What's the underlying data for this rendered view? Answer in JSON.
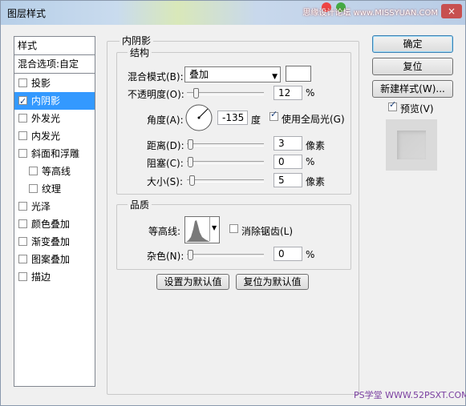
{
  "window": {
    "title": "图层样式",
    "watermark": "思缘设计论坛 www.MISSYUAN.COM",
    "close": "×"
  },
  "styles": {
    "header": "样式",
    "blend_options": "混合选项:自定",
    "items": [
      {
        "label": "投影",
        "checked": false
      },
      {
        "label": "内阴影",
        "checked": true
      },
      {
        "label": "外发光",
        "checked": false
      },
      {
        "label": "内发光",
        "checked": false
      },
      {
        "label": "斜面和浮雕",
        "checked": false
      },
      {
        "label": "等高线",
        "checked": false
      },
      {
        "label": "纹理",
        "checked": false
      },
      {
        "label": "光泽",
        "checked": false
      },
      {
        "label": "颜色叠加",
        "checked": false
      },
      {
        "label": "渐变叠加",
        "checked": false
      },
      {
        "label": "图案叠加",
        "checked": false
      },
      {
        "label": "描边",
        "checked": false
      }
    ]
  },
  "inner_shadow": {
    "title": "内阴影",
    "structure": {
      "title": "结构",
      "blend_mode_label": "混合模式(B):",
      "blend_mode_value": "叠加",
      "swatch_color": "#ffffff",
      "opacity_label": "不透明度(O):",
      "opacity_value": "12",
      "opacity_unit": "%",
      "angle_label": "角度(A):",
      "angle_value": "-135",
      "angle_unit": "度",
      "global_light_label": "使用全局光(G)",
      "global_light": true,
      "distance_label": "距离(D):",
      "distance_value": "3",
      "distance_unit": "像素",
      "choke_label": "阻塞(C):",
      "choke_value": "0",
      "choke_unit": "%",
      "size_label": "大小(S):",
      "size_value": "5",
      "size_unit": "像素"
    },
    "quality": {
      "title": "品质",
      "contour_label": "等高线:",
      "antialias_label": "消除锯齿(L)",
      "antialias": false,
      "noise_label": "杂色(N):",
      "noise_value": "0",
      "noise_unit": "%"
    },
    "make_default": "设置为默认值",
    "reset_default": "复位为默认值"
  },
  "actions": {
    "ok": "确定",
    "reset": "复位",
    "new_style": "新建样式(W)...",
    "preview_label": "预览(V)",
    "preview": true
  },
  "footer_watermark": "PS学堂 WWW.52PSXT.COM"
}
